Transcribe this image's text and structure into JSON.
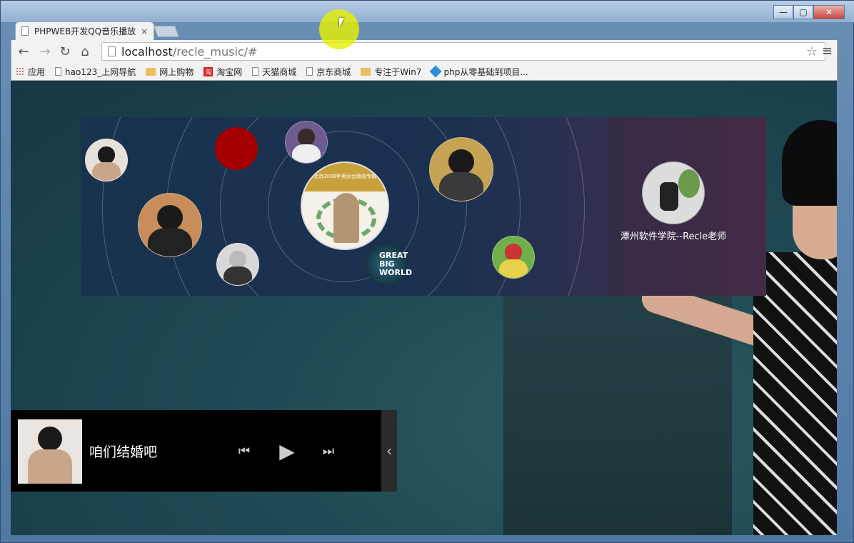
{
  "browser": {
    "tab_title": "PHPWEB开发QQ音乐播放",
    "tab_close": "×",
    "url_host": "localhost",
    "url_path": "/recle_music/#",
    "window_min": "—",
    "window_max": "▢",
    "window_close": "✕"
  },
  "bookmarks": [
    {
      "label": "应用",
      "icon": "apps-icon"
    },
    {
      "label": "hao123_上网导航",
      "icon": "page-icon"
    },
    {
      "label": "网上购物",
      "icon": "folder-icon"
    },
    {
      "label": "淘宝网",
      "icon": "taobao-icon"
    },
    {
      "label": "天猫商城",
      "icon": "page-icon"
    },
    {
      "label": "京东商城",
      "icon": "page-icon"
    },
    {
      "label": "专注于Win7",
      "icon": "folder-icon"
    },
    {
      "label": "php从零基础到项目...",
      "icon": "diamond-icon"
    }
  ],
  "banner": {
    "teacher_name": "潭州软件学院--Recle老师",
    "gbw_text": "GREAT BIG WORLD",
    "center_album_text": "北京2008年奥运会歌曲专辑"
  },
  "player": {
    "song_title": "咱们结婚吧",
    "prev_icon": "⏮",
    "play_icon": "▶",
    "next_icon": "⏭",
    "toggle_icon": "‹"
  },
  "colors": {
    "accent_red": "#a50000",
    "player_bg": "#000000"
  }
}
